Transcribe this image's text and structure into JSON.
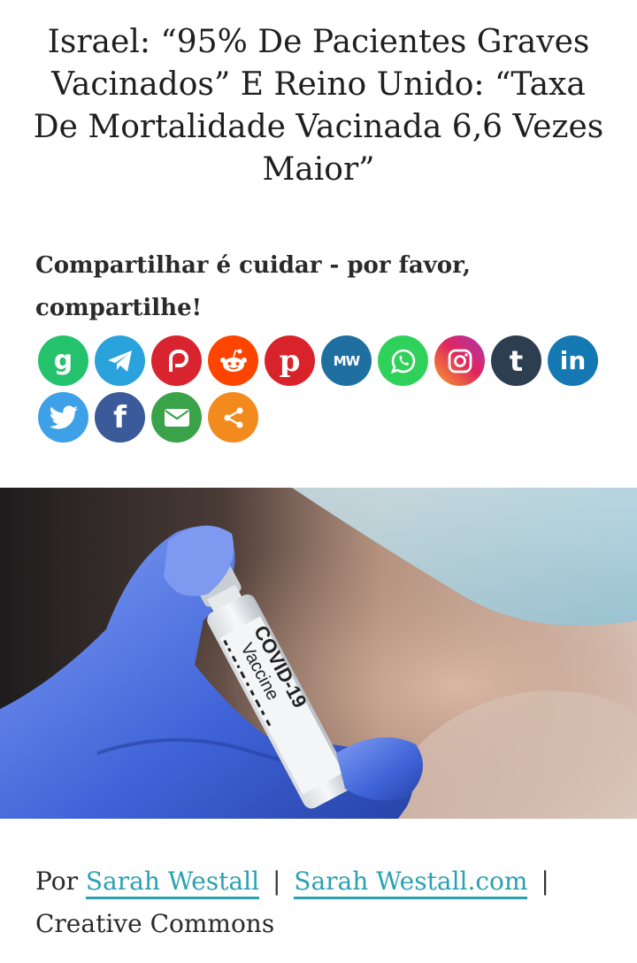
{
  "article": {
    "title": "Israel: “95% De Pacientes Graves Vacinados” E Reino Unido: “Taxa De Mortalidade Vacinada 6,6 Vezes Maior”"
  },
  "share": {
    "heading": "Compartilhar é cuidar - por favor, compartilhe!",
    "buttons": [
      {
        "name": "gab",
        "icon": "gab-icon",
        "color": "#25c26e",
        "glyph": "g"
      },
      {
        "name": "telegram",
        "icon": "telegram-icon",
        "color": "#2aa3dd",
        "glyph": ""
      },
      {
        "name": "parler",
        "icon": "parler-icon",
        "color": "#d8242f",
        "glyph": ""
      },
      {
        "name": "reddit",
        "icon": "reddit-icon",
        "color": "#fe4500",
        "glyph": ""
      },
      {
        "name": "pinterest",
        "icon": "pinterest-icon",
        "color": "#d8232a",
        "glyph": "p"
      },
      {
        "name": "mewe",
        "icon": "mewe-icon",
        "color": "#1f6fa0",
        "glyph": "MW"
      },
      {
        "name": "whatsapp",
        "icon": "whatsapp-icon",
        "color": "#2fd15a",
        "glyph": ""
      },
      {
        "name": "instagram",
        "icon": "instagram-icon",
        "color": "#d6245f",
        "glyph": ""
      },
      {
        "name": "tumblr",
        "icon": "tumblr-icon",
        "color": "#2d3e50",
        "glyph": "t"
      },
      {
        "name": "linkedin",
        "icon": "linkedin-icon",
        "color": "#1479b3",
        "glyph": "in"
      },
      {
        "name": "twitter",
        "icon": "twitter-icon",
        "color": "#3ea1e8",
        "glyph": ""
      },
      {
        "name": "facebook",
        "icon": "facebook-icon",
        "color": "#3b5a9a",
        "glyph": "f"
      },
      {
        "name": "email",
        "icon": "email-icon",
        "color": "#3aa34a",
        "glyph": ""
      },
      {
        "name": "more",
        "icon": "share-icon",
        "color": "#f28a1e",
        "glyph": ""
      }
    ]
  },
  "hero_image": {
    "vial_label_line1": "COVID-19",
    "vial_label_line2": "Vaccine"
  },
  "byline": {
    "prefix": "Por",
    "author": "Sarah Westall",
    "separator": "|",
    "site": "Sarah Westall.com",
    "license": "Creative Commons"
  }
}
